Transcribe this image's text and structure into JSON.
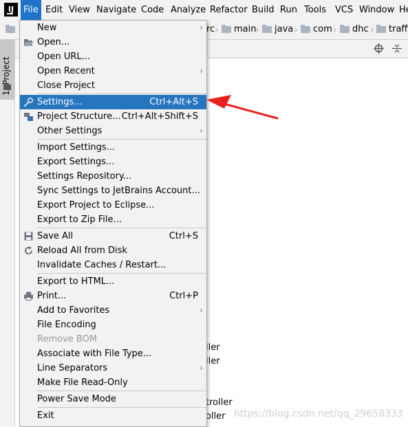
{
  "menubar": {
    "logo": "IJ",
    "items": [
      "File",
      "Edit",
      "View",
      "Navigate",
      "Code",
      "Analyze",
      "Refactor",
      "Build",
      "Run",
      "Tools",
      "VCS",
      "Window",
      "He"
    ]
  },
  "breadcrumb": [
    "rc",
    "main",
    "java",
    "com",
    "dhc",
    "traffi"
  ],
  "sidebar": {
    "tab_label": "1: Project"
  },
  "file_menu": {
    "new": "New",
    "open": "Open...",
    "open_url": "Open URL...",
    "open_recent": "Open Recent",
    "close_project": "Close Project",
    "settings": "Settings...",
    "settings_shortcut": "Ctrl+Alt+S",
    "project_structure": "Project Structure...",
    "project_structure_shortcut": "Ctrl+Alt+Shift+S",
    "other_settings": "Other Settings",
    "import_settings": "Import Settings...",
    "export_settings": "Export Settings...",
    "settings_repository": "Settings Repository...",
    "sync_settings": "Sync Settings to JetBrains Account...",
    "export_eclipse": "Export Project to Eclipse...",
    "export_zip": "Export to Zip File...",
    "save_all": "Save All",
    "save_all_shortcut": "Ctrl+S",
    "reload": "Reload All from Disk",
    "invalidate": "Invalidate Caches / Restart...",
    "export_html": "Export to HTML...",
    "print": "Print...",
    "print_shortcut": "Ctrl+P",
    "add_favorites": "Add to Favorites",
    "file_encoding": "File Encoding",
    "remove_bom": "Remove BOM",
    "associate": "Associate with File Type...",
    "line_separators": "Line Separators",
    "make_readonly": "Make File Read-Only",
    "power_save": "Power Save Mode",
    "exit": "Exit"
  },
  "editor_fragments": [
    "ller",
    "ller",
    "troller",
    "oller"
  ],
  "watermark": "https://blog.csdn.net/qq_29658333",
  "colors": {
    "selection": "#2675bf",
    "annotation_arrow": "#e8201c",
    "menu_bg": "#f2f2f2"
  }
}
